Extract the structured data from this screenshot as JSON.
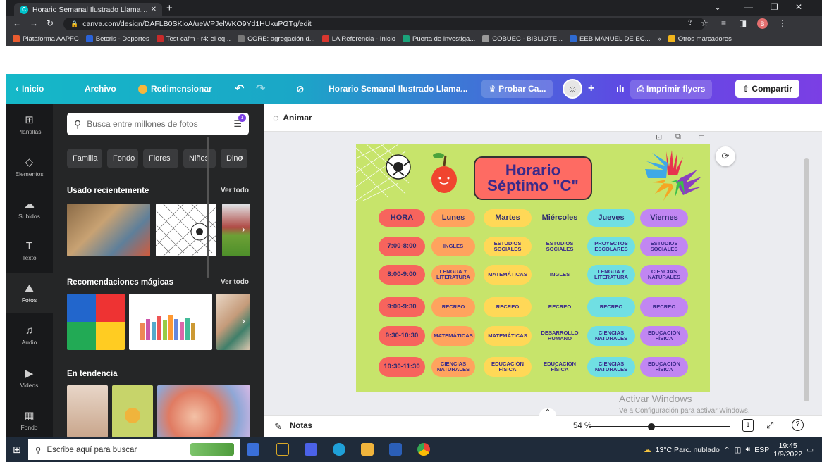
{
  "browser": {
    "tab_title": "Horario Semanal Ilustrado Llama…",
    "new_tab": "+",
    "url": "canva.com/design/DAFLB0SKioA/ueWPJelWKO9Yd1HUkuPGTg/edit",
    "profile_initial": "B",
    "bookmarks": [
      {
        "label": "Plataforma AAPFC",
        "color": "#e95b2f"
      },
      {
        "label": "Betcris - Deportes",
        "color": "#2a62d8"
      },
      {
        "label": "Test cafm - r4: el eq...",
        "color": "#c72a2a"
      },
      {
        "label": "CORE: agregación d...",
        "color": "#777777"
      },
      {
        "label": "LA Referencia - Inicio",
        "color": "#d8372f"
      },
      {
        "label": "Puerta de investiga...",
        "color": "#1aa37a"
      },
      {
        "label": "COBUEC - BIBLIOTE...",
        "color": "#999999"
      },
      {
        "label": "EEB MANUEL DE EC...",
        "color": "#2e6ad1"
      },
      {
        "label": "»",
        "color": ""
      },
      {
        "label": "Otros marcadores",
        "color": "#f2b51c"
      }
    ]
  },
  "header": {
    "inicio": "Inicio",
    "archivo": "Archivo",
    "redimensionar": "Redimensionar",
    "doc_title": "Horario Semanal Ilustrado Llama...",
    "probar": "Probar Ca...",
    "plus": "+",
    "imprimir": "Imprimir flyers",
    "compartir": "Compartir"
  },
  "rail": [
    {
      "label": "Plantillas",
      "icon": "layout-icon"
    },
    {
      "label": "Elementos",
      "icon": "shapes-icon"
    },
    {
      "label": "Subidos",
      "icon": "upload-icon"
    },
    {
      "label": "Texto",
      "icon": "text-icon"
    },
    {
      "label": "Fotos",
      "icon": "photo-icon"
    },
    {
      "label": "Audio",
      "icon": "music-icon"
    },
    {
      "label": "Videos",
      "icon": "video-icon"
    },
    {
      "label": "Fondo",
      "icon": "pattern-icon"
    }
  ],
  "panel": {
    "search_placeholder": "Busca entre millones de fotos",
    "filter_badge": "1",
    "chips": [
      "Familia",
      "Fondo",
      "Flores",
      "Niños",
      "Dine"
    ],
    "recent_title": "Usado recientemente",
    "magic_title": "Recomendaciones mágicas",
    "trending_title": "En tendencia",
    "ver_todo": "Ver todo"
  },
  "canvas": {
    "animar": "Animar",
    "title_line1": "Horario",
    "title_line2": "Séptimo \"C\"",
    "headers": [
      "HORA",
      "Lunes",
      "Martes",
      "Miércoles",
      "Jueves",
      "Viernes"
    ],
    "rows": [
      [
        "7:00-8:00",
        "INGLES",
        "ESTUDIOS SOCIALES",
        "ESTUDIOS SOCIALES",
        "PROYECTOS ESCOLARES",
        "ESTUDIOS SOCIALES"
      ],
      [
        "8:00-9:00",
        "LENGUA Y LITERATURA",
        "MATEMÁTICAS",
        "INGLES",
        "LENGUA Y LITERATURA",
        "CIENCIAS NATURALES"
      ],
      [
        "9:00-9:30",
        "RECREO",
        "RECREO",
        "RECREO",
        "RECREO",
        "RECREO"
      ],
      [
        "9:30-10:30",
        "MATEMÁTICAS",
        "MATEMÁTICAS",
        "DESARROLLO HUMANO",
        "CIENCIAS NATURALES",
        "EDUCACIÓN FÍSICA"
      ],
      [
        "10:30-11:30",
        "CIENCIAS NATURALES",
        "EDUCACIÓN FÍSICA",
        "EDUCACIÓN FÍSICA",
        "CIENCIAS NATURALES",
        "EDUCACIÓN FÍSICA"
      ]
    ],
    "column_colors": [
      "#f7645d",
      "#ffa35e",
      "#ffd857",
      "#c7e46b",
      "#70dfe3",
      "#c186f2"
    ],
    "watermark_title": "Activar Windows",
    "watermark_sub": "Ve a Configuración para activar Windows."
  },
  "bottom": {
    "notas": "Notas",
    "zoom": "54 %",
    "zoom_level": 0.54,
    "page": "1",
    "help": "?"
  },
  "taskbar": {
    "search_placeholder": "Escribe aquí para buscar",
    "weather": "13°C  Parc. nublado",
    "lang": "ESP",
    "time": "19:45",
    "date": "1/9/2022"
  }
}
